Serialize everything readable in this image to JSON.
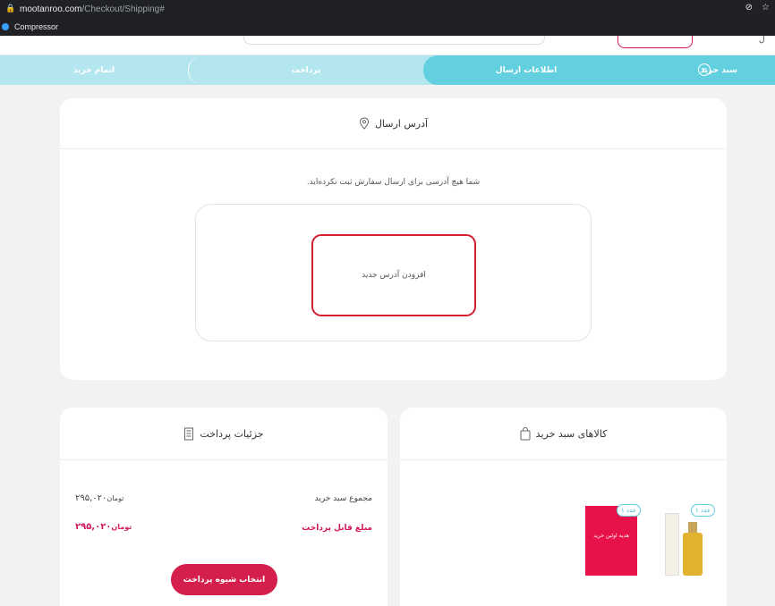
{
  "browser": {
    "url_host": "mootanroo.com",
    "url_path": "/Checkout/Shipping#",
    "bookmark": "Compressor"
  },
  "steps": {
    "cart": "سبد خرید",
    "cart_num": "۲",
    "shipping": "اطلاعات ارسال",
    "payment": "پرداخت",
    "finish": "اتمام خرید"
  },
  "address": {
    "title": "آدرس ارسال",
    "no_address": "شما هیچ آدرسی برای ارسال سفارش ثبت نکرده‌اید.",
    "add_button": "افزودن آدرس جدید"
  },
  "cart": {
    "title": "کالاهای سبد خرید",
    "items": [
      {
        "qty": "۱ عدد"
      },
      {
        "qty": "۱ عدد",
        "name": "هدیه اولین خرید"
      }
    ]
  },
  "payment": {
    "title": "جزئیات پرداخت",
    "subtotal_label": "مجموع سبد خرید",
    "subtotal_value": "۲۹۵,۰۲۰",
    "subtotal_unit": "تومان",
    "total_label": "مبلغ قابل پرداخت",
    "total_value": "۲۹۵,۰۲۰",
    "total_unit": "تومان",
    "button": "انتخاب شیوه پرداخت"
  },
  "colors": {
    "accent": "#63d0e0",
    "brand": "#d41f4d",
    "highlight": "#d41f2d"
  }
}
